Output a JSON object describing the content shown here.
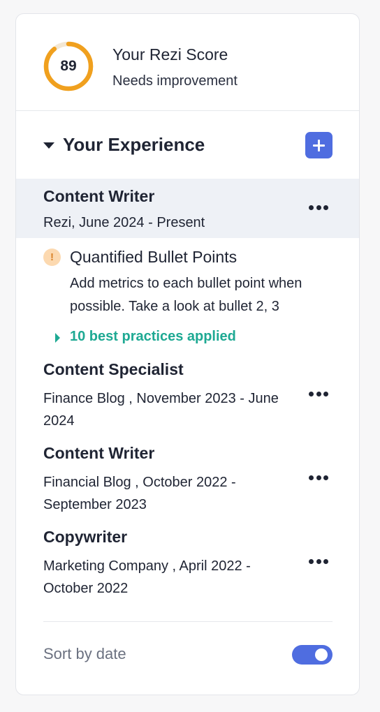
{
  "score": {
    "value": "89",
    "progress_percent": 89,
    "title": "Your Rezi Score",
    "status": "Needs improvement",
    "ring_color": "#f0a01e",
    "track_color": "#f3e7d3"
  },
  "section": {
    "title": "Your Experience",
    "add_icon": "plus-icon",
    "accent": "#4f6de0"
  },
  "experiences": [
    {
      "title": "Content Writer",
      "subtitle": "Rezi, June 2024 - Present",
      "active": true
    },
    {
      "title": "Content Specialist",
      "subtitle": "Finance Blog , November 2023 - June 2024"
    },
    {
      "title": "Content Writer",
      "subtitle": "Financial Blog , October 2022 - September 2023"
    },
    {
      "title": "Copywriter",
      "subtitle": "Marketing Company , April 2022 - October 2022"
    }
  ],
  "feedback": {
    "icon": "exclamation-icon",
    "icon_glyph": "!",
    "title": "Quantified Bullet Points",
    "text": "Add metrics to each bullet point when possible. Take a look at bullet 2, 3",
    "practices_label": "10 best practices applied",
    "practices_color": "#1ea993"
  },
  "footer": {
    "sort_label": "Sort by date",
    "sort_enabled": true
  }
}
